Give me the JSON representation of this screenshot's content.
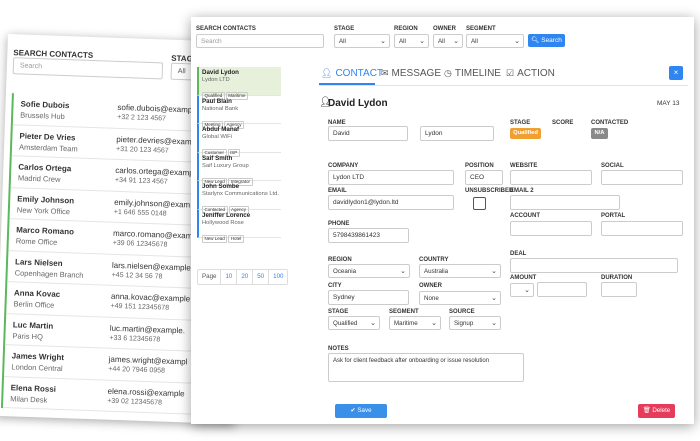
{
  "background": {
    "search_label": "SEARCH CONTACTS",
    "stage_label": "STAG",
    "search_placeholder": "Search",
    "stage_value": "All",
    "rows": [
      {
        "name": "Sofie Dubois",
        "location": "Brussels Hub",
        "email": "sofie.dubois@exampl",
        "phone": "+32 2 123 4567"
      },
      {
        "name": "Pieter De Vries",
        "location": "Amsterdam Team",
        "email": "pieter.devries@exampl",
        "phone": "+31 20 123 4567"
      },
      {
        "name": "Carlos Ortega",
        "location": "Madrid Crew",
        "email": "carlos.ortega@exampl",
        "phone": "+34 91 123 4567"
      },
      {
        "name": "Emily Johnson",
        "location": "New York Office",
        "email": "emily.johnson@exam",
        "phone": "+1 646 555 0148"
      },
      {
        "name": "Marco Romano",
        "location": "Rome Office",
        "email": "marco.romano@exam",
        "phone": "+39 06 12345678"
      },
      {
        "name": "Lars Nielsen",
        "location": "Copenhagen Branch",
        "email": "lars.nielsen@example",
        "phone": "+45 12 34 56 78"
      },
      {
        "name": "Anna Kovac",
        "location": "Berlin Office",
        "email": "anna.kovac@example",
        "phone": "+49 151 12345678"
      },
      {
        "name": "Luc Martin",
        "location": "Paris HQ",
        "email": "luc.martin@example.",
        "phone": "+33 6 12345678"
      },
      {
        "name": "James Wright",
        "location": "London Central",
        "email": "james.wright@exampl",
        "phone": "+44 20 7946 0958"
      },
      {
        "name": "Elena Rossi",
        "location": "Milan Desk",
        "email": "elena.rossi@example",
        "phone": "+39 02 12345678"
      }
    ]
  },
  "filters": {
    "search_label": "SEARCH CONTACTS",
    "search_placeholder": "Search",
    "stage_label": "STAGE",
    "stage_value": "All",
    "region_label": "REGION",
    "region_value": "All",
    "owner_label": "OWNER",
    "owner_value": "All",
    "segment_label": "SEGMENT",
    "segment_value": "All",
    "search_button": "Search"
  },
  "contacts": [
    {
      "name": "David Lydon",
      "company": "Lydon LTD",
      "tags": [
        "Qualified",
        "Maritime"
      ]
    },
    {
      "name": "Paul Blain",
      "company": "National Bank",
      "tags": [
        "Meeting",
        "Agency"
      ]
    },
    {
      "name": "Abdul Manaf",
      "company": "Global WiFi",
      "tags": [
        "Customer",
        "ISP"
      ]
    },
    {
      "name": "Saif Smith",
      "company": "Saif Luxury Group",
      "tags": [
        "New Lead",
        "Integrator"
      ]
    },
    {
      "name": "John Sombe",
      "company": "Starlynx Communications Ltd.",
      "tags": [
        "Contacted",
        "Agency"
      ]
    },
    {
      "name": "Jeniffer Lorence",
      "company": "Hollywood Rose",
      "tags": [
        "New Lead",
        "Hotel"
      ]
    }
  ],
  "pagination": {
    "label": "Page",
    "options": [
      "10",
      "20",
      "50",
      "100"
    ]
  },
  "tabs": {
    "contact": "CONTACT",
    "message": "MESSAGE",
    "timeline": "TIMELINE",
    "action": "ACTION",
    "close": "×"
  },
  "detail": {
    "title": "David Lydon",
    "date": "MAY 13",
    "name_label": "NAME",
    "first_name": "David",
    "last_name": "Lydon",
    "stage_label": "STAGE",
    "stage_value": "Qualified",
    "score_label": "SCORE",
    "contacted_label": "CONTACTED",
    "contacted_value": "N/A",
    "company_label": "COMPANY",
    "company_value": "Lydon LTD",
    "position_label": "POSITION",
    "position_value": "CEO",
    "website_label": "WEBSITE",
    "social_label": "SOCIAL",
    "email_label": "EMAIL",
    "email_value": "davidlydon1@lydon.ltd",
    "unsubscribed_label": "UNSUBSCRIBED",
    "email2_label": "EMAIL 2",
    "account_label": "ACCOUNT",
    "portal_label": "PORTAL",
    "phone_label": "PHONE",
    "phone_value": "5798439861423",
    "deal_label": "DEAL",
    "region_label": "REGION",
    "region_value": "Oceania",
    "country_label": "COUNTRY",
    "country_value": "Australia",
    "amount_label": "AMOUNT",
    "duration_label": "DURATION",
    "city_label": "CITY",
    "city_value": "Sydney",
    "owner_label": "OWNER",
    "owner_value": "None",
    "stage2_label": "STAGE",
    "stage2_value": "Qualified",
    "segment_label": "SEGMENT",
    "segment_value": "Maritime",
    "source_label": "SOURCE",
    "source_value": "Signup",
    "notes_label": "NOTES",
    "notes_value": "Ask for client feedback after onboarding or issue resolution",
    "save_button": "Save",
    "delete_button": "Delete"
  },
  "colors": {
    "accent": "#2f86f0",
    "qualified": "#f0a030",
    "na": "#8a8a8a",
    "delete": "#e63c5a",
    "selected_bg": "#e6f0da"
  }
}
